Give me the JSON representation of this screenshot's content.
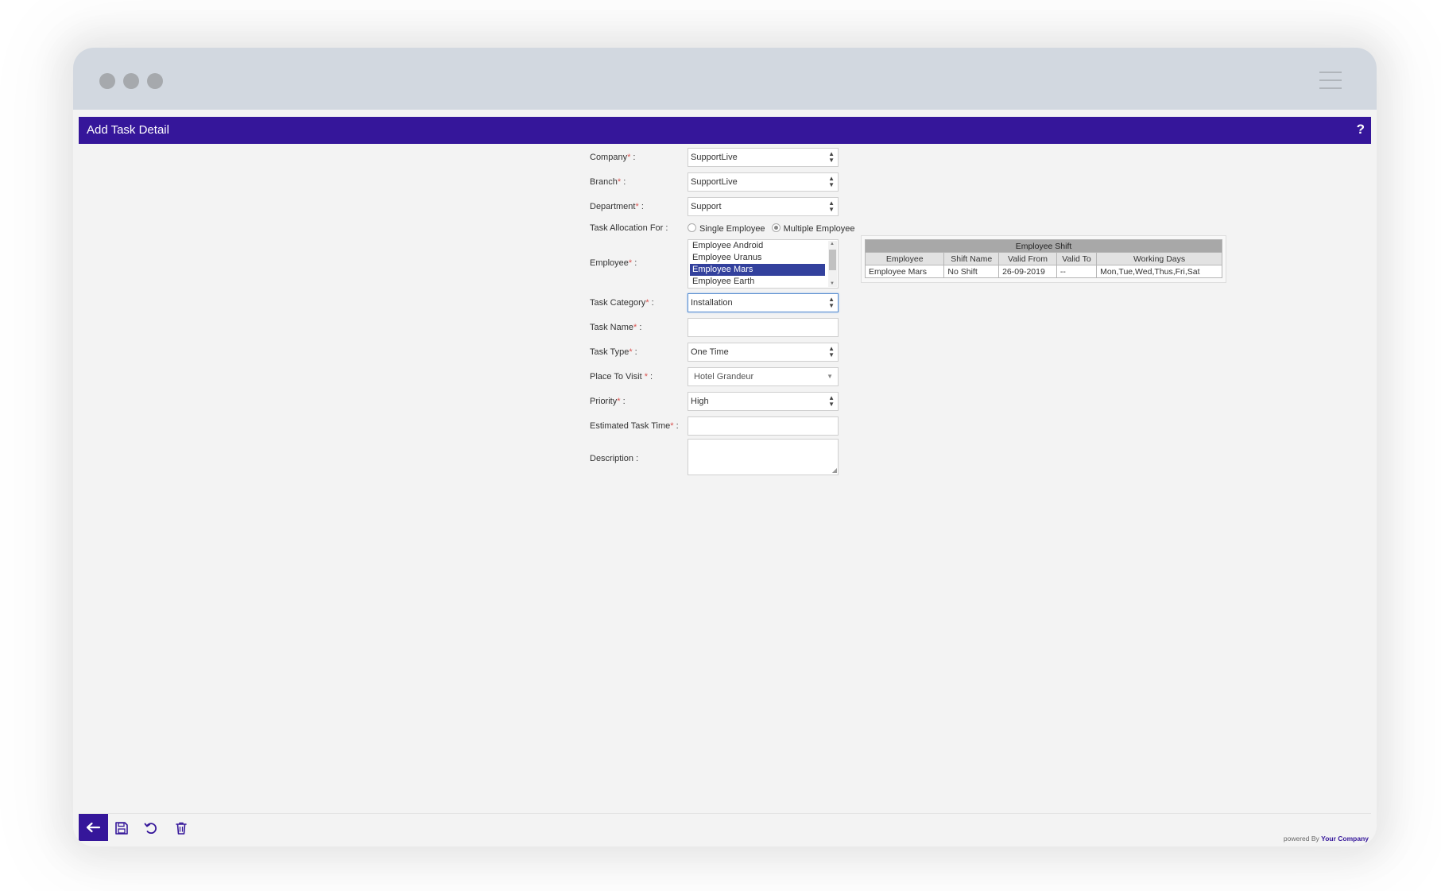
{
  "header": {
    "title": "Add Task Detail",
    "help": "?"
  },
  "form": {
    "company": {
      "label": "Company",
      "value": "SupportLive"
    },
    "branch": {
      "label": "Branch",
      "value": "SupportLive"
    },
    "department": {
      "label": "Department",
      "value": "Support"
    },
    "allocation": {
      "label": "Task Allocation For :",
      "options": [
        "Single Employee",
        "Multiple Employee"
      ],
      "selected": "Multiple Employee"
    },
    "employee": {
      "label": "Employee",
      "options": [
        "Employee Android",
        "Employee Uranus",
        "Employee Mars",
        "Employee Earth"
      ],
      "selected": "Employee Mars"
    },
    "task_category": {
      "label": "Task Category",
      "value": "Installation"
    },
    "task_name": {
      "label": "Task Name",
      "value": ""
    },
    "task_type": {
      "label": "Task Type",
      "value": "One Time"
    },
    "place_to_visit": {
      "label": "Place To Visit",
      "value": "Hotel Grandeur"
    },
    "priority": {
      "label": "Priority",
      "value": "High"
    },
    "estimated_time": {
      "label": "Estimated Task Time",
      "value": ""
    },
    "description": {
      "label": "Description :",
      "value": ""
    },
    "required_marker": "*",
    "colon": ":"
  },
  "shift_table": {
    "caption": "Employee Shift",
    "columns": [
      "Employee",
      "Shift Name",
      "Valid From",
      "Valid To",
      "Working Days"
    ],
    "rows": [
      [
        "Employee Mars",
        "No Shift",
        "26-09-2019",
        "--",
        "Mon,Tue,Wed,Thus,Fri,Sat"
      ]
    ]
  },
  "footer": {
    "powered_prefix": "powered By",
    "company": "Your Company"
  },
  "icons": [
    "back-arrow-icon",
    "save-icon",
    "refresh-icon",
    "trash-icon",
    "menu-icon",
    "help-icon"
  ],
  "colors": {
    "brand": "#35169a",
    "selection": "#33419d",
    "required": "#d9534f"
  }
}
